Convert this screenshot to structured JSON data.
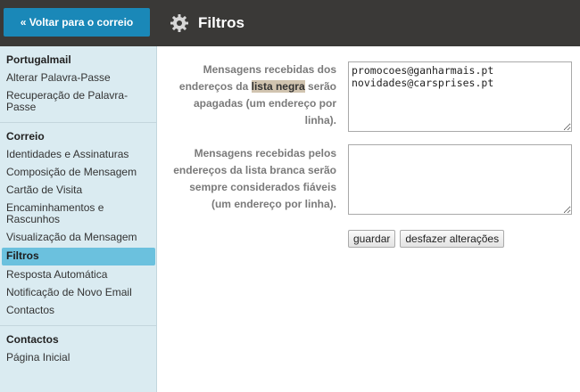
{
  "header": {
    "back_label": "« Voltar para o correio",
    "title": "Filtros",
    "icon": "gear-icon"
  },
  "sidebar": {
    "sections": [
      {
        "heading": "Portugalmail",
        "items": [
          "Alterar Palavra-Passe",
          "Recuperação de Palavra-Passe"
        ]
      },
      {
        "heading": "Correio",
        "items": [
          "Identidades e Assinaturas",
          "Composição de Mensagem",
          "Cartão de Visita",
          "Encaminhamentos e Rascunhos",
          "Visualização da Mensagem",
          "Filtros",
          "Resposta Automática",
          "Notificação de Novo Email",
          "Contactos"
        ]
      },
      {
        "heading": "Contactos",
        "items": [
          "Página Inicial"
        ]
      }
    ],
    "active_item": "Filtros"
  },
  "blacklist": {
    "desc_before": "Mensagens recebidas dos endereços da ",
    "desc_highlight": "lista negra",
    "desc_after": " serão apagadas (um endereço por linha).",
    "value": "promocoes@ganharmais.pt\nnovidades@carsprises.pt"
  },
  "whitelist": {
    "desc": "Mensagens recebidas pelos endereços da lista branca serão sempre considerados fiáveis (um endereço por linha).",
    "value": ""
  },
  "actions": {
    "save_label": "guardar",
    "undo_label": "desfazer alterações"
  },
  "colors": {
    "topbar": "#3a3937",
    "back_button": "#1a88b8",
    "sidebar": "#daebf1",
    "active_item": "#6bc1de"
  }
}
